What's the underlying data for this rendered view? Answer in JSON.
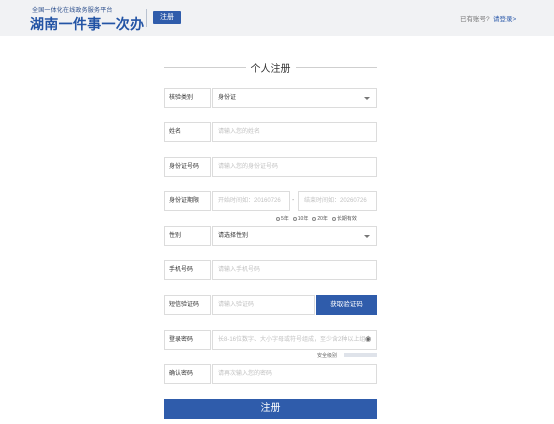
{
  "header": {
    "logo_subtitle": "全国一体化在线政务服务平台",
    "logo_title": "湖南一件事一次办",
    "page_badge": "注册",
    "have_account": "已有账号?",
    "login_link": "请登录>"
  },
  "form": {
    "title": "个人注册",
    "verify_type": {
      "label": "核验类别",
      "value": "身份证"
    },
    "name": {
      "label": "姓名",
      "placeholder": "请输入您的姓名"
    },
    "id_number": {
      "label": "身份证号码",
      "placeholder": "请输入您的身份证号码"
    },
    "id_validity": {
      "label": "身份证期限",
      "start_placeholder": "开始时间如：20160726",
      "separator": "-",
      "end_placeholder": "结束时间如：20260726",
      "options": [
        "5年",
        "10年",
        "20年",
        "长期有效"
      ]
    },
    "gender": {
      "label": "性别",
      "value": "请选择性别"
    },
    "phone": {
      "label": "手机号码",
      "placeholder": "请输入手机号码"
    },
    "sms_code": {
      "label": "短信验证码",
      "placeholder": "请输入验证码",
      "button": "获取验证码"
    },
    "password": {
      "label": "登录密码",
      "placeholder": "长8-16位数字、大小字母或符号组成，至少含2种以上组合",
      "strength_label": "安全级别"
    },
    "confirm_password": {
      "label": "确认密码",
      "placeholder": "请再次输入您的密码"
    },
    "submit": "注册"
  }
}
